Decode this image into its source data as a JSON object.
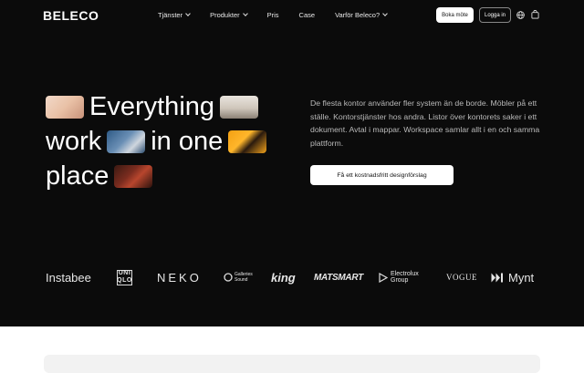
{
  "nav": {
    "logo": "BELECO",
    "menu": [
      {
        "label": "Tjänster",
        "has_dropdown": true
      },
      {
        "label": "Produkter",
        "has_dropdown": true
      },
      {
        "label": "Pris",
        "has_dropdown": false
      },
      {
        "label": "Case",
        "has_dropdown": false
      },
      {
        "label": "Varför Beleco?",
        "has_dropdown": true
      }
    ],
    "book_label": "Boka möte",
    "login_label": "Logga in",
    "icons": [
      "globe-icon",
      "shopping-bag-icon"
    ]
  },
  "hero": {
    "headline_words": [
      "Everything",
      "work",
      "in one",
      "place"
    ],
    "description": "De flesta kontor använder fler system än de borde. Möbler på ett ställe. Kontorstjänster hos andra. Listor över kontorets saker i ett dokument. Avtal i mappar. Workspace samlar allt i en och samma plattform.",
    "cta_label": "Få ett kostnadsfritt designförslag"
  },
  "logos": {
    "instabee": "Instabee",
    "uniqlo_top": "UNI",
    "uniqlo_bottom": "QLO",
    "neko": "NEKO",
    "galleries_1": "Galleries",
    "galleries_2": "Sound",
    "king": "king",
    "matsmart": "MATSMART",
    "electrolux_1": "Electrolux",
    "electrolux_2": "Group",
    "vogue": "VOGUE",
    "mynt": "Mynt"
  },
  "colors": {
    "hero_bg": "#0b0b0b",
    "text": "#ffffff",
    "muted": "#b9b9b9",
    "page_bg": "#ffffff"
  }
}
